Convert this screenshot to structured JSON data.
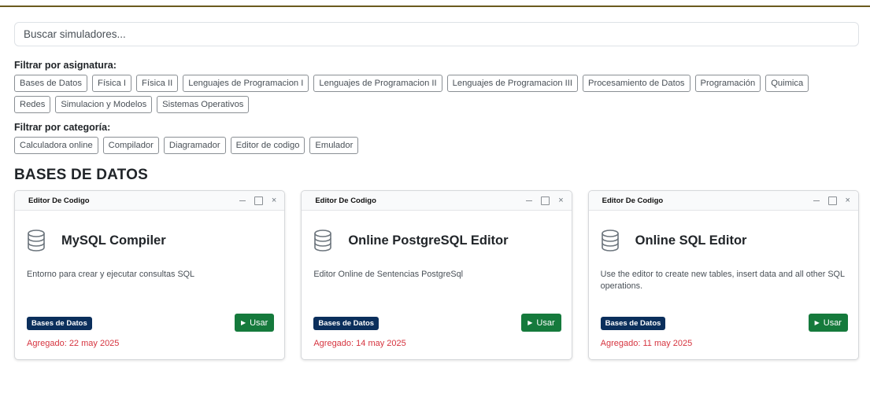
{
  "search": {
    "placeholder": "Buscar simuladores..."
  },
  "filters": {
    "subject_title": "Filtrar por asignatura:",
    "subjects": [
      "Bases de Datos",
      "Física I",
      "Física II",
      "Lenguajes de Programacion I",
      "Lenguajes de Programacion II",
      "Lenguajes de Programacion III",
      "Procesamiento de Datos",
      "Programación",
      "Quimica",
      "Redes",
      "Simulacion y Modelos",
      "Sistemas Operativos"
    ],
    "category_title": "Filtrar por categoría:",
    "categories": [
      "Calculadora online",
      "Compilador",
      "Diagramador",
      "Editor de codigo",
      "Emulador"
    ]
  },
  "section": {
    "title": "BASES DE DATOS"
  },
  "cards": [
    {
      "category": "Editor De Codigo",
      "name": "MySQL Compiler",
      "description": "Entorno para crear y ejecutar consultas SQL",
      "badge": "Bases de Datos",
      "button": "Usar",
      "added": "Agregado: 22 may 2025"
    },
    {
      "category": "Editor De Codigo",
      "name": "Online PostgreSQL Editor",
      "description": "Editor Online de Sentencias PostgreSql",
      "badge": "Bases de Datos",
      "button": "Usar",
      "added": "Agregado: 14 may 2025"
    },
    {
      "category": "Editor De Codigo",
      "name": "Online SQL Editor",
      "description": "Use the editor to create new tables, insert data and all other SQL operations.",
      "badge": "Bases de Datos",
      "button": "Usar",
      "added": "Agregado: 11 may 2025"
    }
  ],
  "icons": {
    "card": "database-icon",
    "play": "play-icon"
  },
  "colors": {
    "badge": "#0b2f5c",
    "use_button": "#157a3c",
    "added_text": "#d6343f",
    "top_line": "#6b5a1e"
  }
}
